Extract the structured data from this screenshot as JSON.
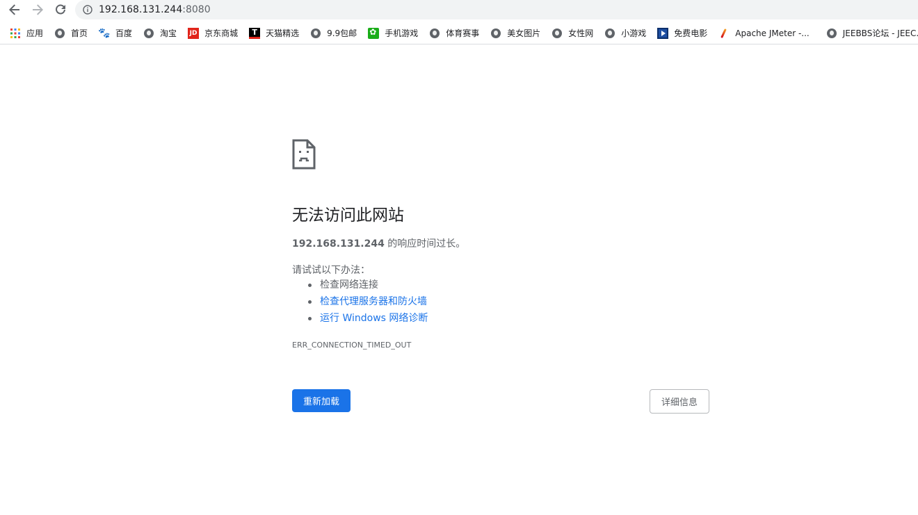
{
  "browser": {
    "url_host": "192.168.131.244",
    "url_port": ":8080"
  },
  "bookmarks": [
    {
      "label": "应用",
      "icon": "apps-grid-icon"
    },
    {
      "label": "首页",
      "icon": "globe-icon"
    },
    {
      "label": "百度",
      "icon": "baidu-paw-icon"
    },
    {
      "label": "淘宝",
      "icon": "globe-icon"
    },
    {
      "label": "京东商城",
      "icon": "jd-logo-icon"
    },
    {
      "label": "天猫精选",
      "icon": "tmall-logo-icon"
    },
    {
      "label": "9.9包邮",
      "icon": "globe-icon"
    },
    {
      "label": "手机游戏",
      "icon": "game-flower-icon"
    },
    {
      "label": "体育赛事",
      "icon": "globe-icon"
    },
    {
      "label": "美女图片",
      "icon": "globe-icon"
    },
    {
      "label": "女性网",
      "icon": "globe-icon"
    },
    {
      "label": "小游戏",
      "icon": "globe-icon"
    },
    {
      "label": "免费电影",
      "icon": "film-play-icon"
    },
    {
      "label": "Apache JMeter -...",
      "icon": "feather-icon"
    },
    {
      "label": "JEEBBS论坛 - JEEC...",
      "icon": "globe-icon"
    }
  ],
  "error": {
    "title": "无法访问此网站",
    "host": "192.168.131.244",
    "summary_suffix": " 的响应时间过长。",
    "suggestions_heading": "请试试以下办法：",
    "suggestions": [
      {
        "label": "检查网络连接",
        "link": false
      },
      {
        "label": "检查代理服务器和防火墙",
        "link": true
      },
      {
        "label": "运行 Windows 网络诊断",
        "link": true
      }
    ],
    "code": "ERR_CONNECTION_TIMED_OUT",
    "reload_label": "重新加载",
    "details_label": "详细信息"
  },
  "colors": {
    "accent": "#1a73e8",
    "text_secondary": "#5f6368"
  }
}
